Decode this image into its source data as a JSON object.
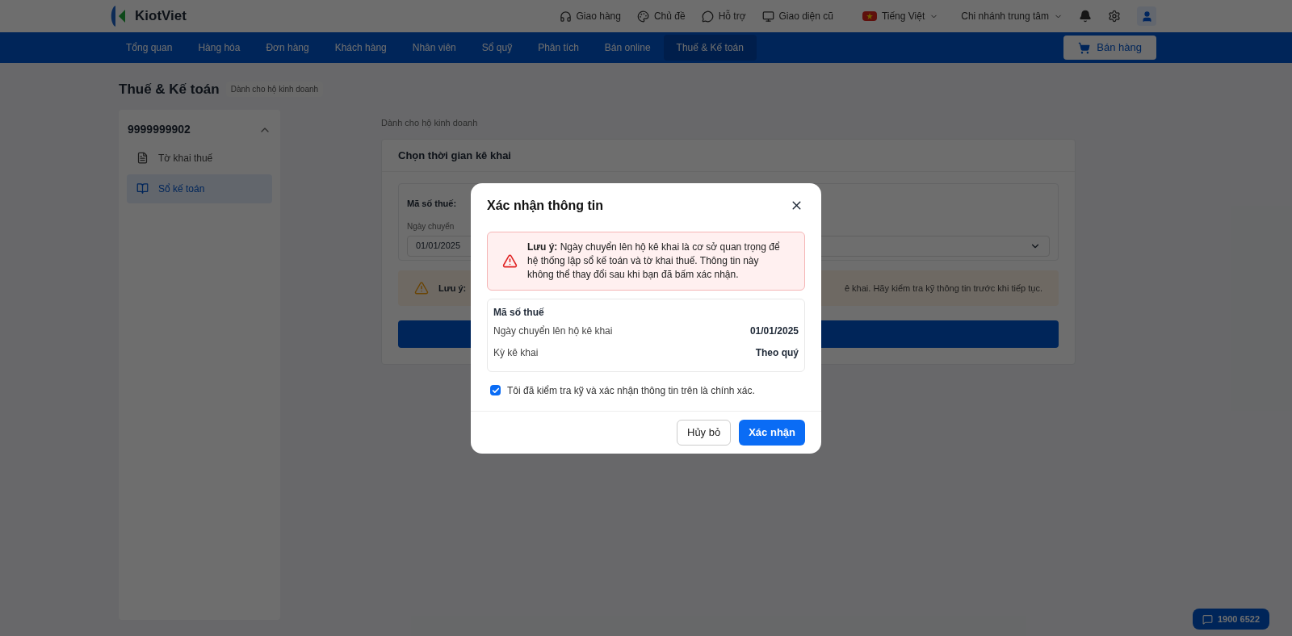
{
  "header": {
    "logo": "KiotViet",
    "links": [
      {
        "kind": "delivery",
        "label": "Giao hàng"
      },
      {
        "kind": "theme",
        "label": "Chủ đề"
      },
      {
        "kind": "support",
        "label": "Hỗ trợ"
      },
      {
        "kind": "classic",
        "label": "Giao diện cũ"
      }
    ],
    "language": "Tiếng Việt",
    "branch": "Chi nhánh trung tâm"
  },
  "nav": {
    "tabs": [
      {
        "label": "Tổng quan",
        "selected": false
      },
      {
        "label": "Hàng hóa",
        "selected": false
      },
      {
        "label": "Đơn hàng",
        "selected": false
      },
      {
        "label": "Khách hàng",
        "selected": false
      },
      {
        "label": "Nhân viên",
        "selected": false
      },
      {
        "label": "Sổ quỹ",
        "selected": false
      },
      {
        "label": "Phân tích",
        "selected": false
      },
      {
        "label": "Bán online",
        "selected": false
      },
      {
        "label": "Thuế & Kế toán",
        "selected": true
      }
    ],
    "sell_button": "Bán hàng"
  },
  "page": {
    "title": "Thuế & Kế toán",
    "badge": "Dành cho hộ kinh doanh"
  },
  "sidebar": {
    "group": "9999999902",
    "expanded": true,
    "items": [
      {
        "kind": "declaration",
        "label": "Tờ khai thuế",
        "selected": false
      },
      {
        "kind": "ledger",
        "label": "Sổ kế toán",
        "selected": true
      }
    ]
  },
  "content": {
    "subtitle": "Dành cho hộ kinh doanh",
    "card_title": "Chọn thời gian kê khai",
    "tax_code_label": "Mã số thuế:",
    "date_label": "Ngày chuyển",
    "date_value": "01/01/2025",
    "warning_label": "Lưu ý:",
    "warning_tail": "ê khai. Hãy kiểm tra kỹ thông tin trước khi tiếp tục."
  },
  "hotline": "1900 6522",
  "modal": {
    "title": "Xác nhận thông tin",
    "alert": "**Lưu ý:** Ngày chuyển lên hộ kê khai là cơ sở quan trọng để hệ thống lập sổ kế toán và tờ khai thuế. Thông tin này không thể thay đổi sau khi bạn đã bấm xác nhận.",
    "summary_title": "Mã số thuế",
    "rows": [
      {
        "label": "Ngày chuyển lên hộ kê khai",
        "value": "01/01/2025"
      },
      {
        "label": "Kỳ kê khai",
        "value": "Theo quý"
      }
    ],
    "confirm": {
      "label": "Tôi đã kiểm tra kỹ và xác nhận thông tin trên là chính xác.",
      "checked": true
    },
    "cancel": "Hủy bỏ",
    "submit": "Xác nhận"
  }
}
